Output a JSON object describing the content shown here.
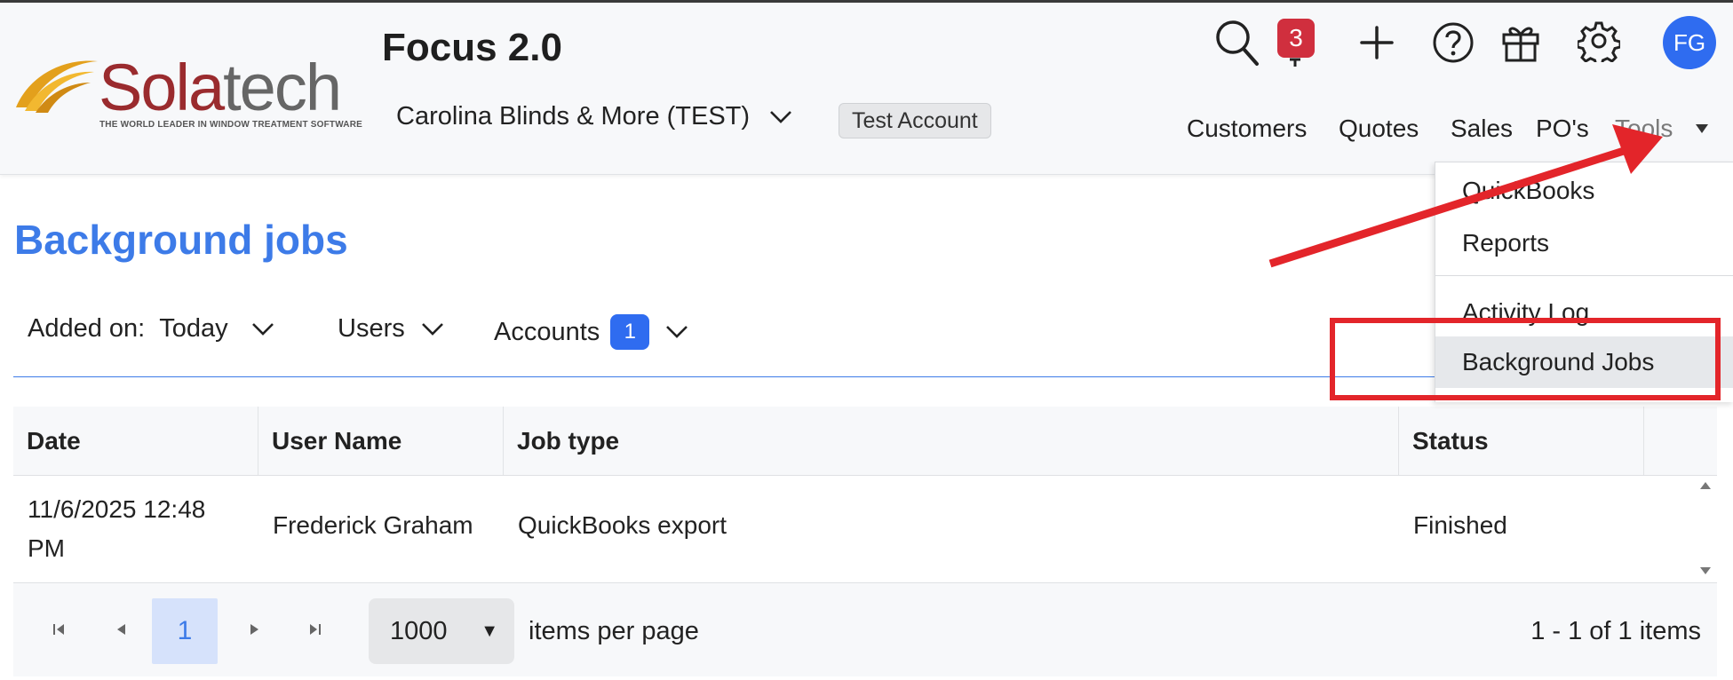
{
  "brand": {
    "logo_word_part1": "Sola",
    "logo_word_part2": "tech",
    "logo_tagline": "THE WORLD LEADER IN WINDOW TREATMENT SOFTWARE",
    "app_title": "Focus 2.0"
  },
  "header": {
    "company_name": "Carolina Blinds & More (TEST)",
    "account_badge": "Test Account",
    "notification_count": "3",
    "avatar_initials": "FG",
    "nav": [
      "Customers",
      "Quotes",
      "Sales",
      "PO's",
      "Tools"
    ]
  },
  "tools_menu": {
    "items": [
      "QuickBooks",
      "Reports",
      "Activity Log",
      "Background Jobs"
    ],
    "active": "Background Jobs"
  },
  "page": {
    "title": "Background jobs"
  },
  "filters": {
    "added_on_label": "Added on:",
    "added_on_value": "Today",
    "users_label": "Users",
    "accounts_label": "Accounts",
    "accounts_count": "1"
  },
  "table": {
    "columns": [
      "Date",
      "User Name",
      "Job type",
      "Status"
    ],
    "rows": [
      {
        "date_line1": "11/6/2025 12:48",
        "date_line2": "PM",
        "user": "Frederick Graham",
        "job_type": "QuickBooks export",
        "status": "Finished"
      }
    ]
  },
  "pager": {
    "current_page": "1",
    "page_size": "1000",
    "page_size_label": "items per page",
    "info": "1 - 1 of 1 items"
  },
  "colors": {
    "accent": "#3d7be8",
    "annotation_red": "#e3252a",
    "badge_red": "#d02f3e"
  }
}
